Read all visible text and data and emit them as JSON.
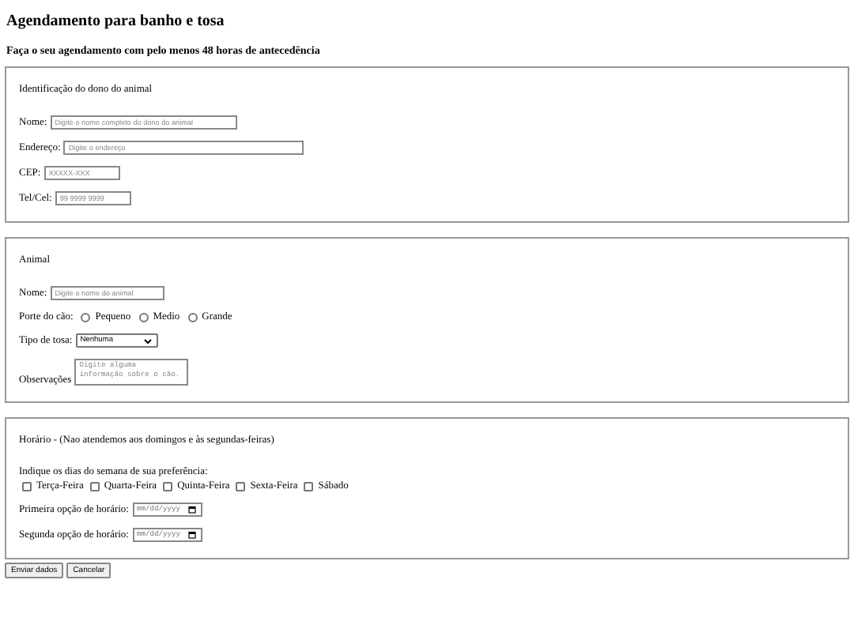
{
  "title": "Agendamento para banho e tosa",
  "subtitle": "Faça o seu agendamento com pelo menos 48 horas de antecedência",
  "owner": {
    "legend": "Identificação do dono do animal",
    "fields": [
      {
        "label": "Nome:",
        "placeholder": "Digite o nome completo do dono do animal"
      },
      {
        "label": "Endereço:",
        "placeholder": "Digite o endereço"
      },
      {
        "label": "CEP:",
        "placeholder": "XXXXX-XXX"
      },
      {
        "label": "Tel/Cel:",
        "placeholder": "99 9999 9999"
      }
    ]
  },
  "animal": {
    "legend": "Animal",
    "name": {
      "label": "Nome:",
      "placeholder": "Digite o nome do animal"
    },
    "size": {
      "label": "Porte do cão:",
      "options": [
        {
          "label": "Pequeno",
          "selected": false
        },
        {
          "label": "Medio",
          "selected": false
        },
        {
          "label": "Grande",
          "selected": false
        }
      ]
    },
    "grooming": {
      "label": "Tipo de tosa:",
      "value": "Nenhuma"
    },
    "notes": {
      "label": "Observações",
      "placeholder": "Digite alguma informação sobre o cão."
    }
  },
  "schedule": {
    "legend": "Horário - (Nao atendemos aos domingos e às segundas-feiras)",
    "days_label": "Indique os dias do semana de sua preferência:",
    "days": [
      {
        "label": "Terça-Feira",
        "checked": false
      },
      {
        "label": "Quarta-Feira",
        "checked": false
      },
      {
        "label": "Quinta-Feira",
        "checked": false
      },
      {
        "label": "Sexta-Feira",
        "checked": false
      },
      {
        "label": "Sábado",
        "checked": false
      }
    ],
    "dates": [
      {
        "label": "Primeira opção de horário:",
        "placeholder": "mm/dd/yyyy"
      },
      {
        "label": "Segunda opção de horário:",
        "placeholder": "mm/dd/yyyy"
      }
    ]
  },
  "buttons": [
    "Enviar dados",
    "Cancelar"
  ]
}
